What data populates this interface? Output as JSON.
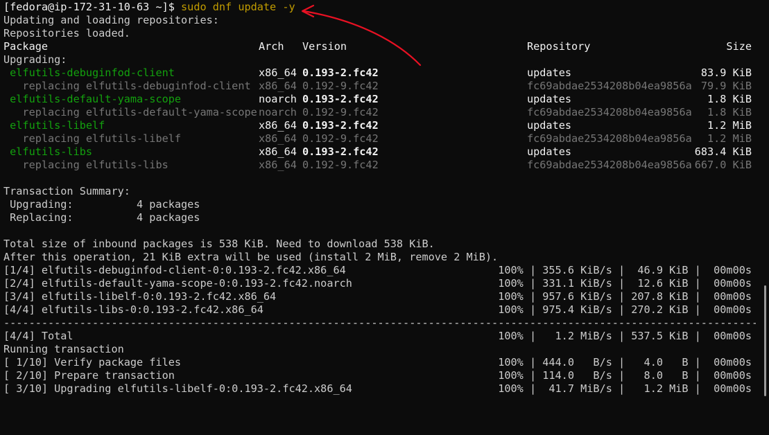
{
  "prompt": {
    "text": "[fedora@ip-172-31-10-63 ~]$ ",
    "command": "sudo dnf update -y"
  },
  "preamble": [
    "Updating and loading repositories:",
    "Repositories loaded."
  ],
  "table_headers": {
    "package": "Package",
    "arch": "Arch",
    "version": "Version",
    "repository": "Repository",
    "size": "Size"
  },
  "upgrading_label": "Upgrading:",
  "packages": [
    {
      "name": " elfutils-debuginfod-client",
      "arch": "x86_64",
      "version": "0.193-2.fc42",
      "repo": "updates",
      "size": " 83.9 KiB"
    },
    {
      "name": "   replacing elfutils-debuginfod-client",
      "arch": "x86_64",
      "version": "0.192-9.fc42",
      "repo": "fc69abdae2534208b04ea9856a",
      "size": " 79.9 KiB"
    },
    {
      "name": " elfutils-default-yama-scope",
      "arch": "noarch",
      "version": "0.193-2.fc42",
      "repo": "updates",
      "size": "  1.8 KiB"
    },
    {
      "name": "   replacing elfutils-default-yama-scope",
      "arch": "noarch",
      "version": "0.192-9.fc42",
      "repo": "fc69abdae2534208b04ea9856a",
      "size": "  1.8 KiB"
    },
    {
      "name": " elfutils-libelf",
      "arch": "x86_64",
      "version": "0.193-2.fc42",
      "repo": "updates",
      "size": "  1.2 MiB"
    },
    {
      "name": "   replacing elfutils-libelf",
      "arch": "x86_64",
      "version": "0.192-9.fc42",
      "repo": "fc69abdae2534208b04ea9856a",
      "size": "  1.2 MiB"
    },
    {
      "name": " elfutils-libs",
      "arch": "x86_64",
      "version": "0.193-2.fc42",
      "repo": "updates",
      "size": "683.4 KiB"
    },
    {
      "name": "   replacing elfutils-libs",
      "arch": "x86_64",
      "version": "0.192-9.fc42",
      "repo": "fc69abdae2534208b04ea9856a",
      "size": "667.0 KiB"
    }
  ],
  "summary": {
    "title": "Transaction Summary:",
    "upgrading": " Upgrading:          4 packages",
    "replacing": " Replacing:          4 packages"
  },
  "totals": [
    "Total size of inbound packages is 538 KiB. Need to download 538 KiB.",
    "After this operation, 21 KiB extra will be used (install 2 MiB, remove 2 MiB)."
  ],
  "downloads": [
    {
      "name": "[1/4] elfutils-debuginfod-client-0:0.193-2.fc42.x86_64",
      "stats": "100% | 355.6 KiB/s |  46.9 KiB |  00m00s"
    },
    {
      "name": "[2/4] elfutils-default-yama-scope-0:0.193-2.fc42.noarch",
      "stats": "100% | 331.1 KiB/s |  12.6 KiB |  00m00s"
    },
    {
      "name": "[3/4] elfutils-libelf-0:0.193-2.fc42.x86_64",
      "stats": "100% | 957.6 KiB/s | 207.8 KiB |  00m00s"
    },
    {
      "name": "[4/4] elfutils-libs-0:0.193-2.fc42.x86_64",
      "stats": "100% | 975.4 KiB/s | 270.2 KiB |  00m00s"
    }
  ],
  "separator": "------------------------------------------------------------------------------------------------------------------------",
  "total_line": {
    "name": "[4/4] Total",
    "stats": "100% |   1.2 MiB/s | 537.5 KiB |  00m00s"
  },
  "running": "Running transaction",
  "steps": [
    {
      "name": "[ 1/10] Verify package files",
      "stats": "100% | 444.0   B/s |   4.0   B |  00m00s"
    },
    {
      "name": "[ 2/10] Prepare transaction",
      "stats": "100% | 114.0   B/s |   8.0   B |  00m00s"
    },
    {
      "name": "[ 3/10] Upgrading elfutils-libelf-0:0.193-2.fc42.x86_64",
      "stats": "100% |  41.7 MiB/s |   1.2 MiB |  00m00s"
    }
  ],
  "colors": {
    "background": "#0c0c0c",
    "text": "#cccccc",
    "command": "#c19c00",
    "package_new": "#13a10e",
    "dim": "#767676",
    "annotation_arrow": "#e81123"
  }
}
